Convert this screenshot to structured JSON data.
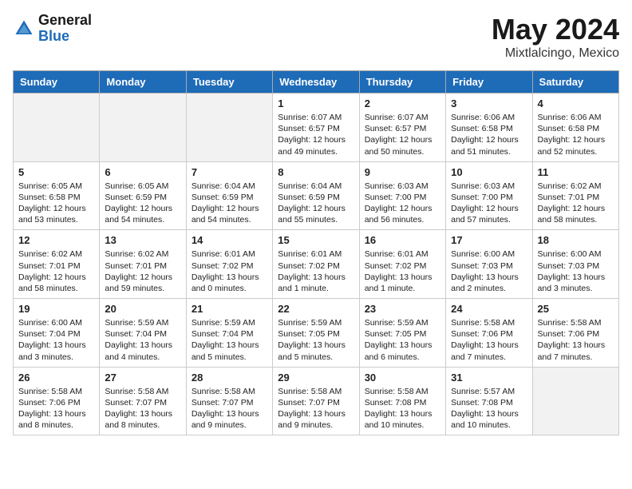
{
  "header": {
    "logo_general": "General",
    "logo_blue": "Blue",
    "month_year": "May 2024",
    "location": "Mixtlalcingo, Mexico"
  },
  "weekdays": [
    "Sunday",
    "Monday",
    "Tuesday",
    "Wednesday",
    "Thursday",
    "Friday",
    "Saturday"
  ],
  "weeks": [
    [
      {
        "day": "",
        "info": "",
        "gray": true
      },
      {
        "day": "",
        "info": "",
        "gray": true
      },
      {
        "day": "",
        "info": "",
        "gray": true
      },
      {
        "day": "1",
        "info": "Sunrise: 6:07 AM\nSunset: 6:57 PM\nDaylight: 12 hours\nand 49 minutes.",
        "gray": false
      },
      {
        "day": "2",
        "info": "Sunrise: 6:07 AM\nSunset: 6:57 PM\nDaylight: 12 hours\nand 50 minutes.",
        "gray": false
      },
      {
        "day": "3",
        "info": "Sunrise: 6:06 AM\nSunset: 6:58 PM\nDaylight: 12 hours\nand 51 minutes.",
        "gray": false
      },
      {
        "day": "4",
        "info": "Sunrise: 6:06 AM\nSunset: 6:58 PM\nDaylight: 12 hours\nand 52 minutes.",
        "gray": false
      }
    ],
    [
      {
        "day": "5",
        "info": "Sunrise: 6:05 AM\nSunset: 6:58 PM\nDaylight: 12 hours\nand 53 minutes.",
        "gray": false
      },
      {
        "day": "6",
        "info": "Sunrise: 6:05 AM\nSunset: 6:59 PM\nDaylight: 12 hours\nand 54 minutes.",
        "gray": false
      },
      {
        "day": "7",
        "info": "Sunrise: 6:04 AM\nSunset: 6:59 PM\nDaylight: 12 hours\nand 54 minutes.",
        "gray": false
      },
      {
        "day": "8",
        "info": "Sunrise: 6:04 AM\nSunset: 6:59 PM\nDaylight: 12 hours\nand 55 minutes.",
        "gray": false
      },
      {
        "day": "9",
        "info": "Sunrise: 6:03 AM\nSunset: 7:00 PM\nDaylight: 12 hours\nand 56 minutes.",
        "gray": false
      },
      {
        "day": "10",
        "info": "Sunrise: 6:03 AM\nSunset: 7:00 PM\nDaylight: 12 hours\nand 57 minutes.",
        "gray": false
      },
      {
        "day": "11",
        "info": "Sunrise: 6:02 AM\nSunset: 7:01 PM\nDaylight: 12 hours\nand 58 minutes.",
        "gray": false
      }
    ],
    [
      {
        "day": "12",
        "info": "Sunrise: 6:02 AM\nSunset: 7:01 PM\nDaylight: 12 hours\nand 58 minutes.",
        "gray": false
      },
      {
        "day": "13",
        "info": "Sunrise: 6:02 AM\nSunset: 7:01 PM\nDaylight: 12 hours\nand 59 minutes.",
        "gray": false
      },
      {
        "day": "14",
        "info": "Sunrise: 6:01 AM\nSunset: 7:02 PM\nDaylight: 13 hours\nand 0 minutes.",
        "gray": false
      },
      {
        "day": "15",
        "info": "Sunrise: 6:01 AM\nSunset: 7:02 PM\nDaylight: 13 hours\nand 1 minute.",
        "gray": false
      },
      {
        "day": "16",
        "info": "Sunrise: 6:01 AM\nSunset: 7:02 PM\nDaylight: 13 hours\nand 1 minute.",
        "gray": false
      },
      {
        "day": "17",
        "info": "Sunrise: 6:00 AM\nSunset: 7:03 PM\nDaylight: 13 hours\nand 2 minutes.",
        "gray": false
      },
      {
        "day": "18",
        "info": "Sunrise: 6:00 AM\nSunset: 7:03 PM\nDaylight: 13 hours\nand 3 minutes.",
        "gray": false
      }
    ],
    [
      {
        "day": "19",
        "info": "Sunrise: 6:00 AM\nSunset: 7:04 PM\nDaylight: 13 hours\nand 3 minutes.",
        "gray": false
      },
      {
        "day": "20",
        "info": "Sunrise: 5:59 AM\nSunset: 7:04 PM\nDaylight: 13 hours\nand 4 minutes.",
        "gray": false
      },
      {
        "day": "21",
        "info": "Sunrise: 5:59 AM\nSunset: 7:04 PM\nDaylight: 13 hours\nand 5 minutes.",
        "gray": false
      },
      {
        "day": "22",
        "info": "Sunrise: 5:59 AM\nSunset: 7:05 PM\nDaylight: 13 hours\nand 5 minutes.",
        "gray": false
      },
      {
        "day": "23",
        "info": "Sunrise: 5:59 AM\nSunset: 7:05 PM\nDaylight: 13 hours\nand 6 minutes.",
        "gray": false
      },
      {
        "day": "24",
        "info": "Sunrise: 5:58 AM\nSunset: 7:06 PM\nDaylight: 13 hours\nand 7 minutes.",
        "gray": false
      },
      {
        "day": "25",
        "info": "Sunrise: 5:58 AM\nSunset: 7:06 PM\nDaylight: 13 hours\nand 7 minutes.",
        "gray": false
      }
    ],
    [
      {
        "day": "26",
        "info": "Sunrise: 5:58 AM\nSunset: 7:06 PM\nDaylight: 13 hours\nand 8 minutes.",
        "gray": false
      },
      {
        "day": "27",
        "info": "Sunrise: 5:58 AM\nSunset: 7:07 PM\nDaylight: 13 hours\nand 8 minutes.",
        "gray": false
      },
      {
        "day": "28",
        "info": "Sunrise: 5:58 AM\nSunset: 7:07 PM\nDaylight: 13 hours\nand 9 minutes.",
        "gray": false
      },
      {
        "day": "29",
        "info": "Sunrise: 5:58 AM\nSunset: 7:07 PM\nDaylight: 13 hours\nand 9 minutes.",
        "gray": false
      },
      {
        "day": "30",
        "info": "Sunrise: 5:58 AM\nSunset: 7:08 PM\nDaylight: 13 hours\nand 10 minutes.",
        "gray": false
      },
      {
        "day": "31",
        "info": "Sunrise: 5:57 AM\nSunset: 7:08 PM\nDaylight: 13 hours\nand 10 minutes.",
        "gray": false
      },
      {
        "day": "",
        "info": "",
        "gray": true
      }
    ]
  ]
}
